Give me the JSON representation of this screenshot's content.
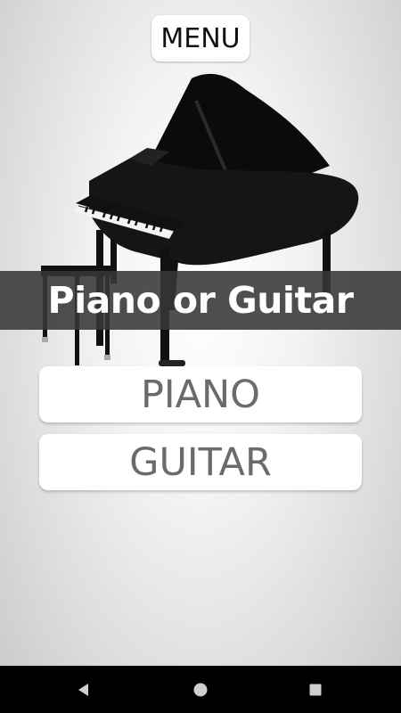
{
  "app": {
    "menu_label": "MENU",
    "title": "Piano or Guitar"
  },
  "choices": {
    "piano_label": "PIANO",
    "guitar_label": "GUITAR"
  },
  "illustration": {
    "icon": "grand-piano-icon"
  },
  "navigation": {
    "back_icon": "back-triangle-icon",
    "home_icon": "home-circle-icon",
    "recents_icon": "recents-square-icon"
  },
  "colors": {
    "banner": "#373737",
    "button_text": "#6b6b6b",
    "nav_bar": "#000000"
  }
}
